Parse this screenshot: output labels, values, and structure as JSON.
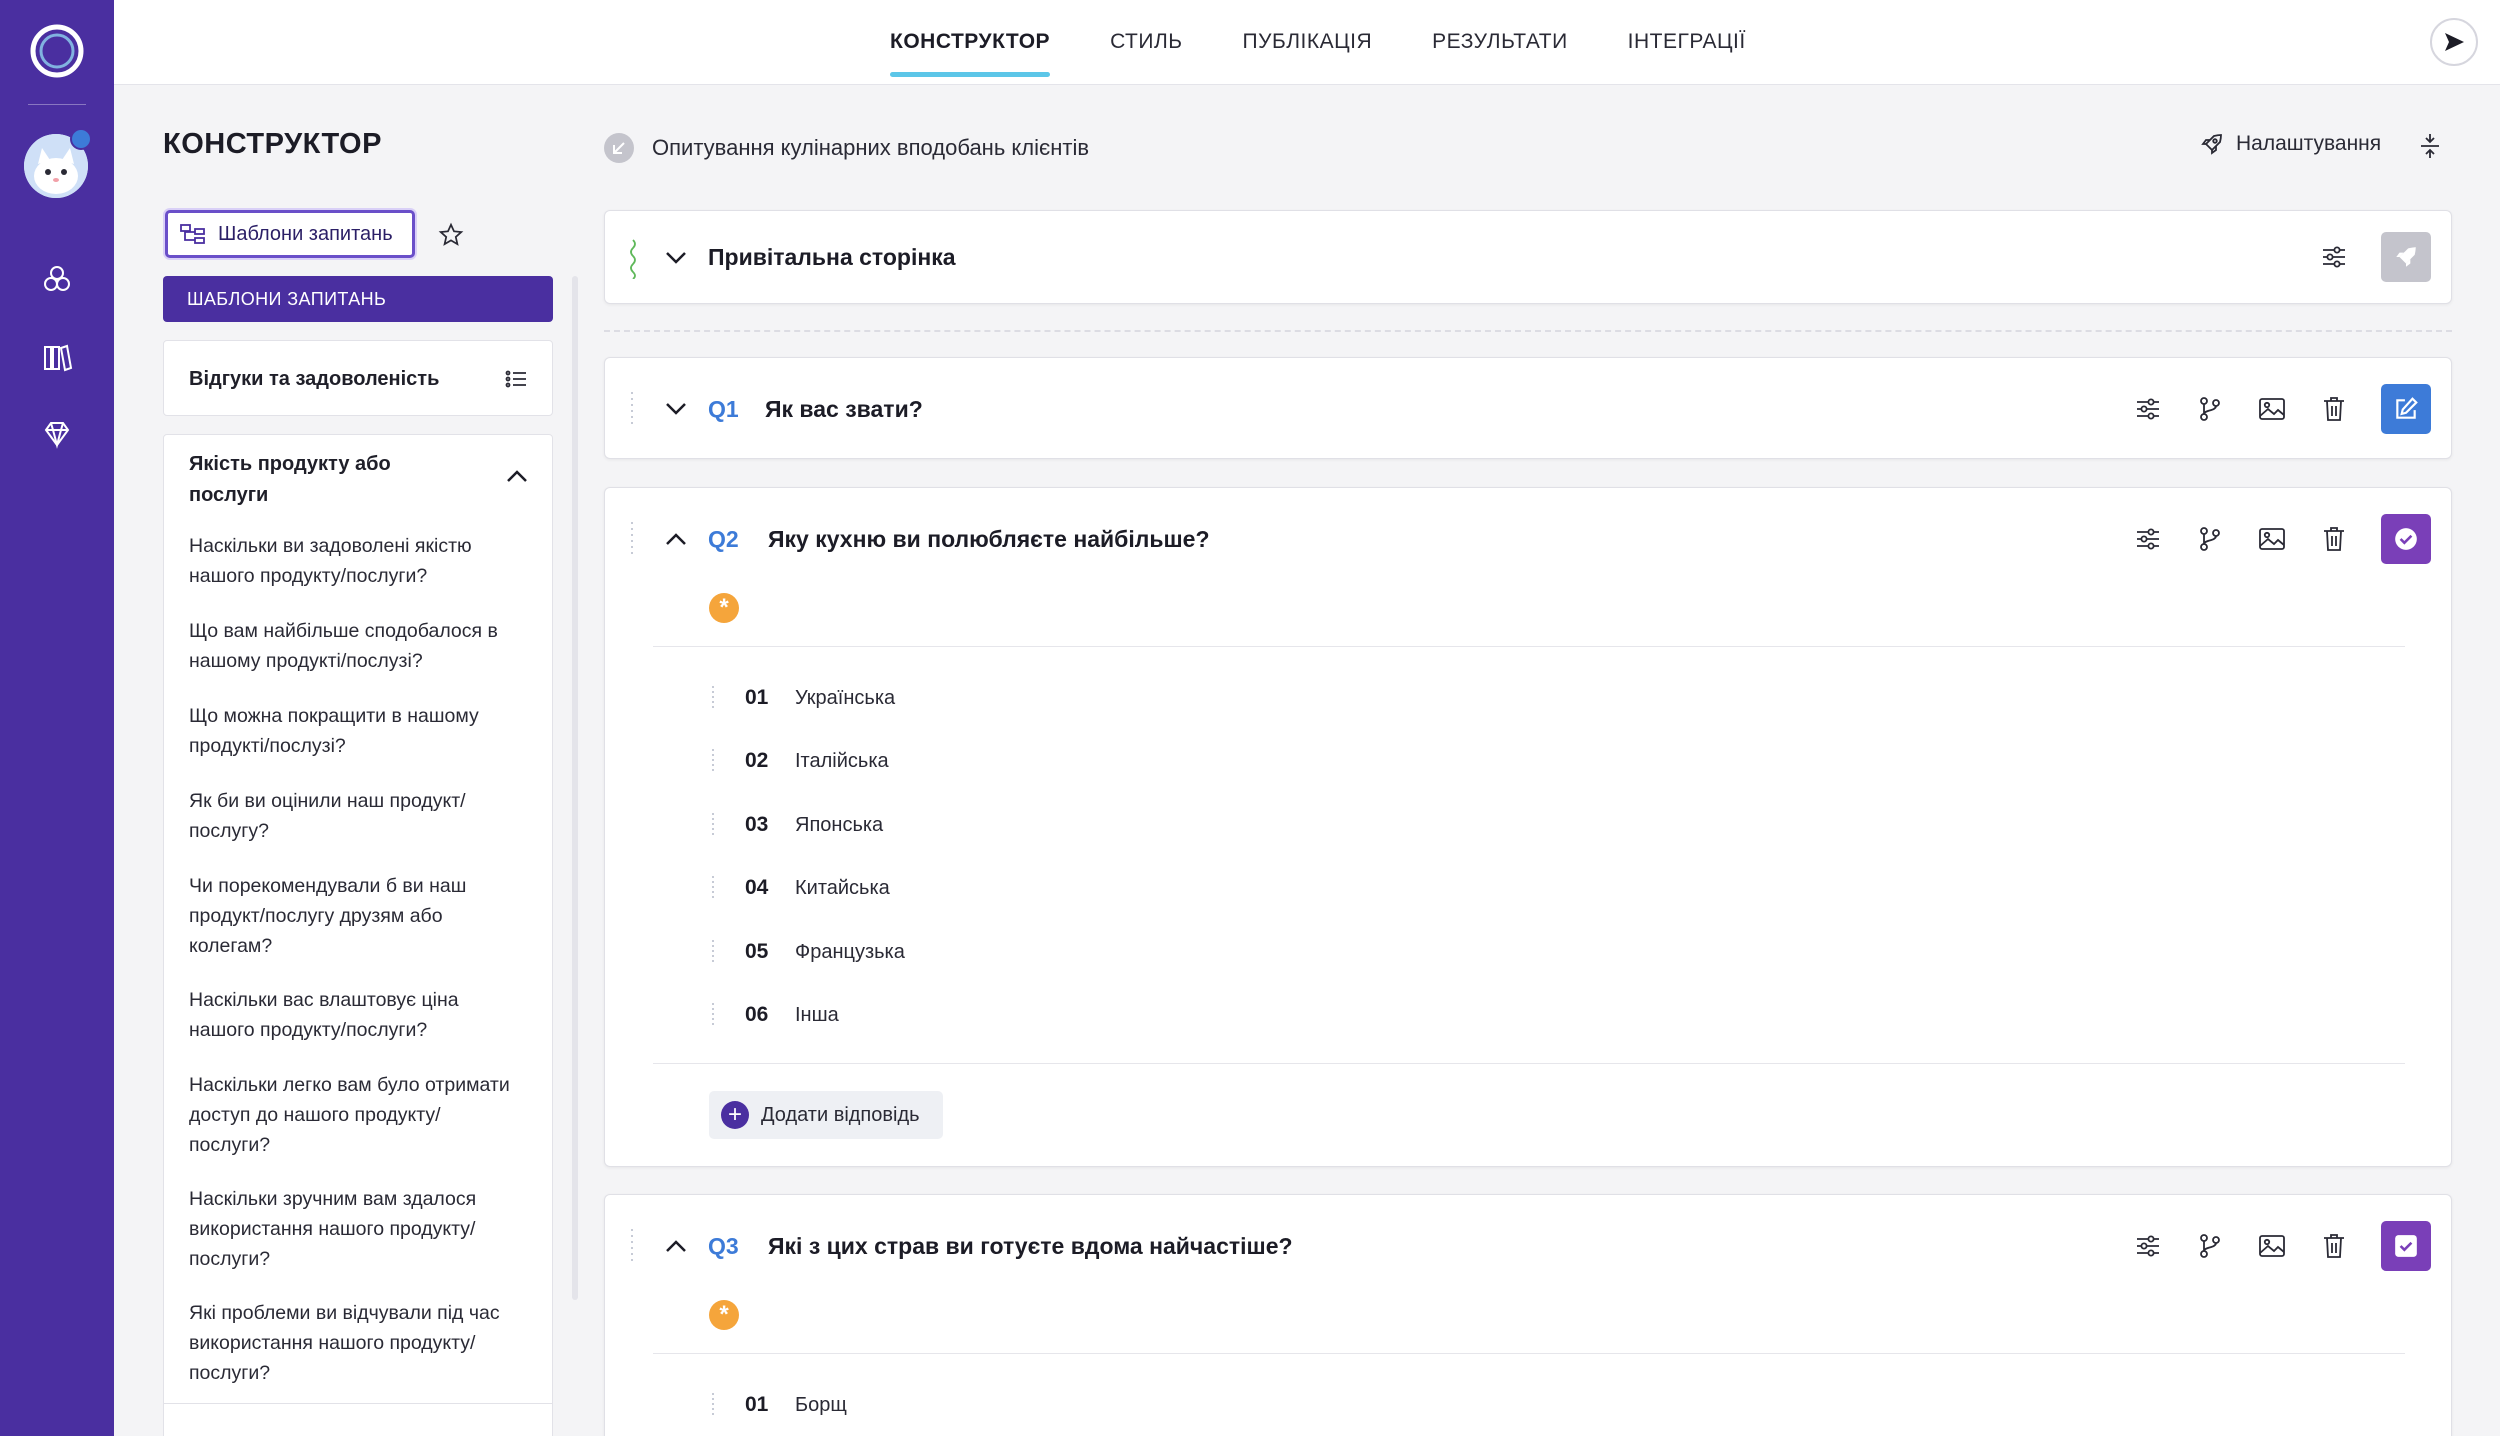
{
  "topbar": {
    "tabs": [
      {
        "label": "КОНСТРУКТОР",
        "active": true
      },
      {
        "label": "СТИЛЬ",
        "active": false
      },
      {
        "label": "ПУБЛІКАЦІЯ",
        "active": false
      },
      {
        "label": "РЕЗУЛЬТАТИ",
        "active": false
      },
      {
        "label": "ІНТЕГРАЦІЇ",
        "active": false
      }
    ]
  },
  "sidebar": {
    "icons": [
      "logo-icon",
      "avatar",
      "modules-icon",
      "library-icon",
      "diamond-icon"
    ]
  },
  "left_panel": {
    "title": "КОНСТРУКТОР",
    "templates_button": "Шаблони запитань",
    "templates_header": "ШАБЛОНИ ЗАПИТАНЬ",
    "category_collapsed": "Відгуки та задоволеність",
    "category_open": {
      "title": "Якість продукту або послуги",
      "items": [
        "Наскільки ви задоволені якістю нашого продукту/послуги?",
        "Що вам найбільше сподобалося в нашому продукті/послузі?",
        "Що можна покращити в нашому продукті/послузі?",
        "Як би ви оцінили наш продукт/ послугу?",
        "Чи порекомендували б ви наш продукт/послугу друзям або колегам?",
        "Наскільки вас влаштовує ціна нашого продукту/послуги?",
        "Наскільки легко вам було отримати доступ до нашого продукту/ послуги?",
        "Наскільки зручним вам здалося використання нашого продукту/ послуги?",
        "Які проблеми ви відчували під час використання нашого продукту/ послуги?"
      ]
    }
  },
  "main": {
    "survey_title": "Опитування кулінарних вподобань клієнтів",
    "settings_label": "Налаштування",
    "welcome_title": "Привітальна сторінка",
    "questions": [
      {
        "num": "Q1",
        "text": "Як вас звати?",
        "status_color": "#3d7bd8"
      },
      {
        "num": "Q2",
        "text": "Яку кухню ви полюбляєте найбільше?",
        "required_mark": "*",
        "status_color": "#7a3fb8",
        "answers": [
          {
            "num": "01",
            "label": "Українська"
          },
          {
            "num": "02",
            "label": "Італійська"
          },
          {
            "num": "03",
            "label": "Японська"
          },
          {
            "num": "04",
            "label": "Китайська"
          },
          {
            "num": "05",
            "label": "Французька"
          },
          {
            "num": "06",
            "label": "Інша"
          }
        ],
        "add_answer": "Додати відповідь"
      },
      {
        "num": "Q3",
        "text": "Які з цих страв ви готуєте вдома найчастіше?",
        "required_mark": "*",
        "status_color": "#7a3fb8",
        "answers": [
          {
            "num": "01",
            "label": "Борщ"
          }
        ]
      }
    ]
  },
  "colors": {
    "brand": "#4a2fa0",
    "accent": "#5cc6e8",
    "question_num": "#3d7bd8",
    "required": "#f5a53b"
  }
}
